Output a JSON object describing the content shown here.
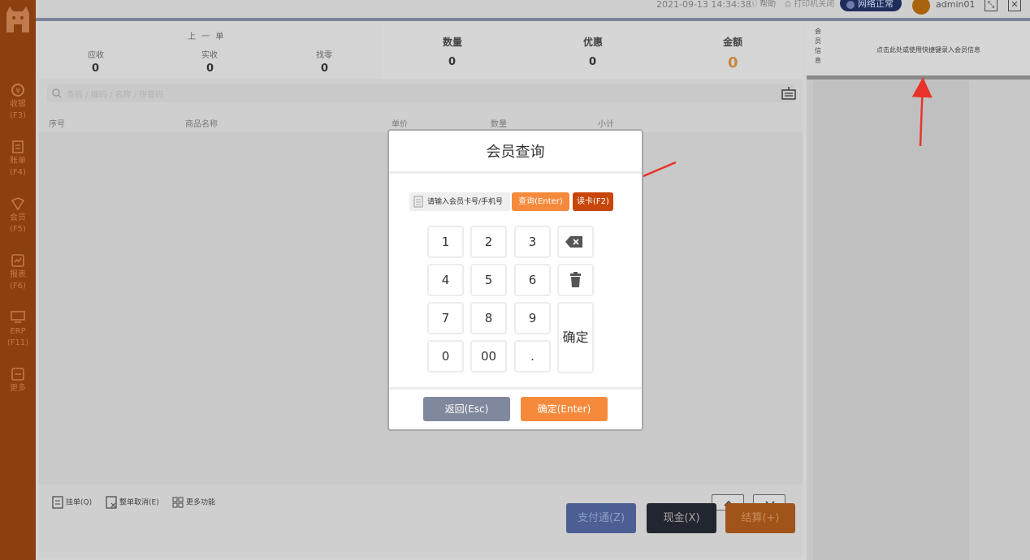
{
  "sidebar": {
    "items": [
      {
        "label": "收银",
        "key": "(F3)",
        "icon": "cashier-icon"
      },
      {
        "label": "账单",
        "key": "(F4)",
        "icon": "bill-icon"
      },
      {
        "label": "会员",
        "key": "(F5)",
        "icon": "member-icon"
      },
      {
        "label": "报表",
        "key": "(F6)",
        "icon": "report-icon"
      },
      {
        "label": "ERP",
        "key": "(F11)",
        "icon": "erp-icon"
      },
      {
        "label": "更多",
        "key": "",
        "icon": "more-icon"
      }
    ]
  },
  "topbar": {
    "datetime": "2021-09-13 14:34:38",
    "help": "帮助",
    "printer": "打印机关闭",
    "network": "网络正常",
    "user": "admin01"
  },
  "summary": {
    "prev_order_title": "上 一 单",
    "receivable_label": "应收",
    "receivable_value": "0",
    "received_label": "实收",
    "received_value": "0",
    "change_label": "找零",
    "change_value": "0",
    "qty_label": "数量",
    "qty_value": "0",
    "discount_label": "优惠",
    "discount_value": "0",
    "amount_label": "金额",
    "amount_value": "0"
  },
  "search": {
    "placeholder": "条码 / 编码 / 名称 / 拼音码"
  },
  "table": {
    "columns": [
      "序号",
      "商品名称",
      "单价",
      "数量",
      "小计"
    ]
  },
  "tools": {
    "hang": "挂单(Q)",
    "cancel_all": "整单取消(E)",
    "more": "更多功能"
  },
  "pay": {
    "alipay": "支付通(Z)",
    "cash": "现金(X)",
    "checkout": "结算(+)"
  },
  "member_panel": {
    "tag": "会员信息",
    "tip": "点击此处或使用快捷键录入会员信息"
  },
  "modal": {
    "title": "会员查询",
    "input_placeholder": "请输入会员卡号/手机号",
    "query": "查询(Enter)",
    "read_card": "读卡(F2)",
    "keys": [
      "1",
      "2",
      "3",
      "4",
      "5",
      "6",
      "7",
      "8",
      "9",
      "0",
      "00",
      "."
    ],
    "confirm_key": "确定",
    "back": "返回(Esc)",
    "confirm": "确定(Enter)"
  },
  "colors": {
    "sidebar": "#8c3f0f",
    "orange": "#f58a3c",
    "dark_orange": "#c8460a",
    "slate": "#7f889c"
  }
}
